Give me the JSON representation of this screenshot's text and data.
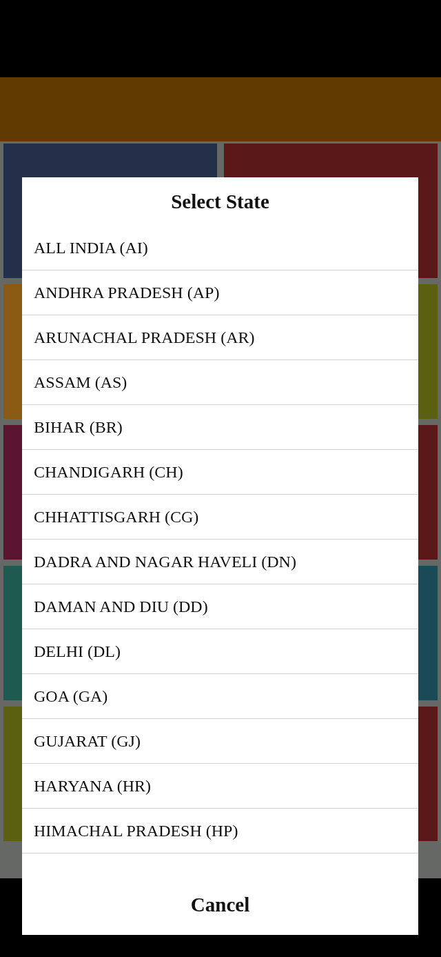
{
  "dialog": {
    "title": "Select State",
    "options": [
      {
        "label": "ALL INDIA (AI)"
      },
      {
        "label": "ANDHRA PRADESH (AP)"
      },
      {
        "label": "ARUNACHAL PRADESH (AR)"
      },
      {
        "label": "ASSAM (AS)"
      },
      {
        "label": "BIHAR (BR)"
      },
      {
        "label": "CHANDIGARH (CH)"
      },
      {
        "label": "CHHATTISGARH (CG)"
      },
      {
        "label": "DADRA AND NAGAR HAVELI (DN)"
      },
      {
        "label": "DAMAN AND DIU (DD)"
      },
      {
        "label": "DELHI (DL)"
      },
      {
        "label": "GOA (GA)"
      },
      {
        "label": "GUJARAT (GJ)"
      },
      {
        "label": "HARYANA (HR)"
      },
      {
        "label": "HIMACHAL PRADESH (HP)"
      }
    ],
    "cancel": "Cancel"
  }
}
